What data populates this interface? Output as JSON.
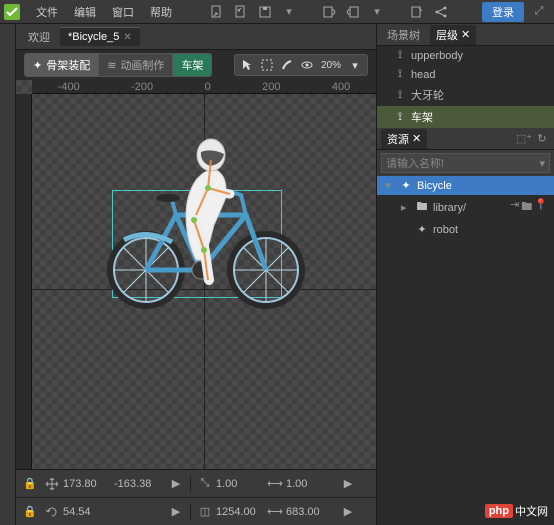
{
  "app": {
    "menus": [
      "文件",
      "编辑",
      "窗口",
      "帮助"
    ],
    "login": "登录"
  },
  "tabs": {
    "welcome": "欢迎",
    "doc": "*Bicycle_5"
  },
  "ruler": {
    "ticks": [
      "-400",
      "-200",
      "0",
      "200",
      "400"
    ]
  },
  "mode": {
    "rigging": "骨架装配",
    "anim": "动画制作",
    "frame": "车架",
    "opacity": "20%"
  },
  "status": {
    "posX": "173.80",
    "posY": "-163.38",
    "rot": "54.54",
    "sizeW": "1254.00",
    "sizeH": "683.00",
    "scaleX": "1.00",
    "scaleY": "1.00"
  },
  "panels": {
    "sceneTree": "场景树",
    "hierarchy": "层级",
    "resources": "资源",
    "searchPlaceholder": "请输入名称!"
  },
  "hierarchy": {
    "items": [
      "upperbody",
      "head",
      "大牙轮",
      "车架"
    ]
  },
  "resources": {
    "root": "Bicycle",
    "folder": "library/",
    "item": "robot"
  },
  "watermark": {
    "brand": "php",
    "suffix": "中文网"
  }
}
